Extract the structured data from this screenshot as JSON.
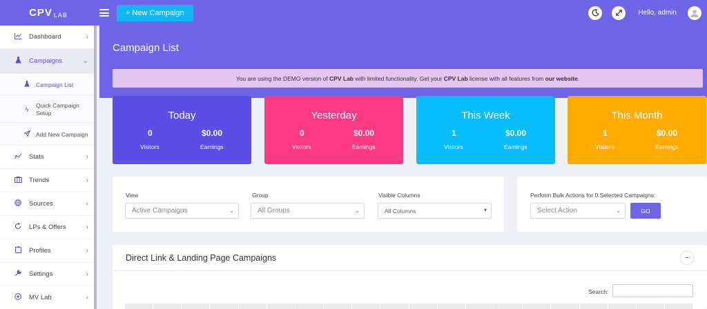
{
  "topbar": {
    "logo_main": "CPV",
    "logo_sub": "LAB",
    "new_campaign_label": "New Campaign",
    "greeting": "Hello, admin"
  },
  "sidebar": {
    "items": [
      {
        "label": "Dashboard",
        "icon": "chart-line-icon"
      },
      {
        "label": "Campaigns",
        "icon": "flask-icon"
      },
      {
        "label": "Stats",
        "icon": "chart-trend-icon"
      },
      {
        "label": "Trends",
        "icon": "columns-icon"
      },
      {
        "label": "Sources",
        "icon": "globe-icon"
      },
      {
        "label": "LPs & Offers",
        "icon": "refresh-icon"
      },
      {
        "label": "Profiles",
        "icon": "clipboard-icon"
      },
      {
        "label": "Settings",
        "icon": "wrench-icon"
      },
      {
        "label": "MV Lab",
        "icon": "lab-icon"
      }
    ],
    "sub_items": [
      {
        "label": "Campaign List",
        "icon": "flask-icon"
      },
      {
        "label": "Quick Campaign",
        "label2": "Setup",
        "icon": "bolt-icon"
      },
      {
        "label": "Add New Campaign",
        "icon": "paper-plane-icon"
      }
    ]
  },
  "page": {
    "title": "Campaign List",
    "notice_prefix": "You are using the DEMO version of ",
    "notice_brand": "CPV Lab",
    "notice_middle": " with limited functionality. Get your ",
    "notice_brand2": "CPV Lab",
    "notice_mid2": " license with all features from ",
    "notice_link": "our website",
    "notice_end": "."
  },
  "stats": [
    {
      "title": "Today",
      "visitors": "0",
      "earnings": "$0.00",
      "visitors_label": "Visitors",
      "earnings_label": "Earnings",
      "color": "#5b4ee6"
    },
    {
      "title": "Yesterday",
      "visitors": "0",
      "earnings": "$0.00",
      "visitors_label": "Visitors",
      "earnings_label": "Earnings",
      "color": "#fb3a83"
    },
    {
      "title": "This Week",
      "visitors": "1",
      "earnings": "$0.00",
      "visitors_label": "Visitors",
      "earnings_label": "Earnings",
      "color": "#08bdf9"
    },
    {
      "title": "This Month",
      "visitors": "1",
      "earnings": "$0.00",
      "visitors_label": "Visitors",
      "earnings_label": "Earnings",
      "color": "#ffab00"
    }
  ],
  "filters": {
    "view_label": "View",
    "view_value": "Active Campaigns",
    "group_label": "Group",
    "group_value": "All Groups",
    "columns_label": "Visible Columns",
    "columns_value": "All Columns"
  },
  "bulk": {
    "label": "Perform Bulk Actions for 0 Selected Campaigns:",
    "select_value": "Select Action",
    "go_label": "GO"
  },
  "table": {
    "title": "Direct Link & Landing Page Campaigns",
    "collapse_symbol": "−",
    "search_label": "Search:"
  }
}
